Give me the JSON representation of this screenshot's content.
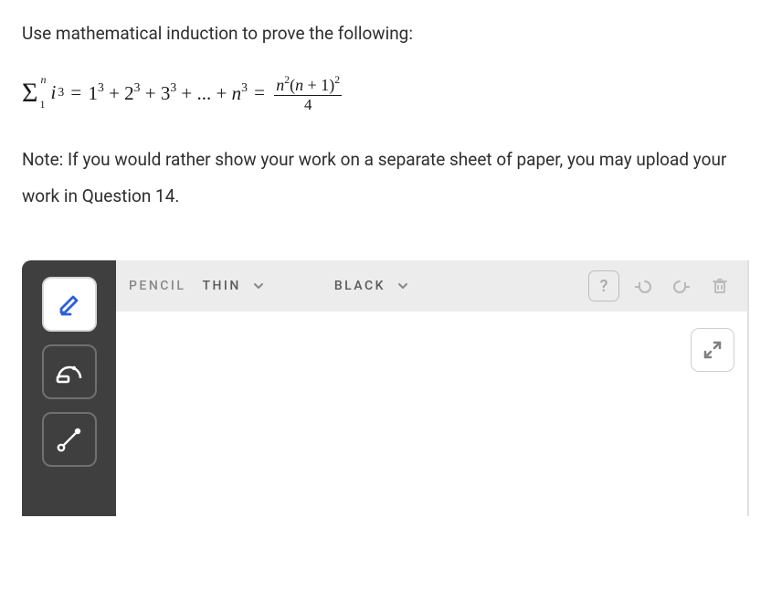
{
  "question": {
    "prompt": "Use mathematical induction to prove the following:",
    "note": "Note: If you would rather show your work on a separate sheet of paper, you may upload your work in Question 14.",
    "equation": {
      "lhs_sigma_upper": "n",
      "lhs_sigma_lower": "1",
      "lhs_term": "i",
      "lhs_exp": "3",
      "expansion": "1^3 + 2^3 + 3^3 + ... + n^3",
      "rhs_numerator": "n^2(n + 1)^2",
      "rhs_denominator": "4"
    }
  },
  "toolbar": {
    "tool_label": "PENCIL",
    "thickness": {
      "selected": "THIN"
    },
    "color": {
      "selected": "BLACK"
    }
  },
  "icons": {
    "pencil": "pencil-icon",
    "protractor": "protractor-icon",
    "line": "line-icon",
    "help": "?",
    "undo": "undo-icon",
    "redo": "redo-icon",
    "trash": "trash-icon",
    "expand": "expand-icon"
  }
}
